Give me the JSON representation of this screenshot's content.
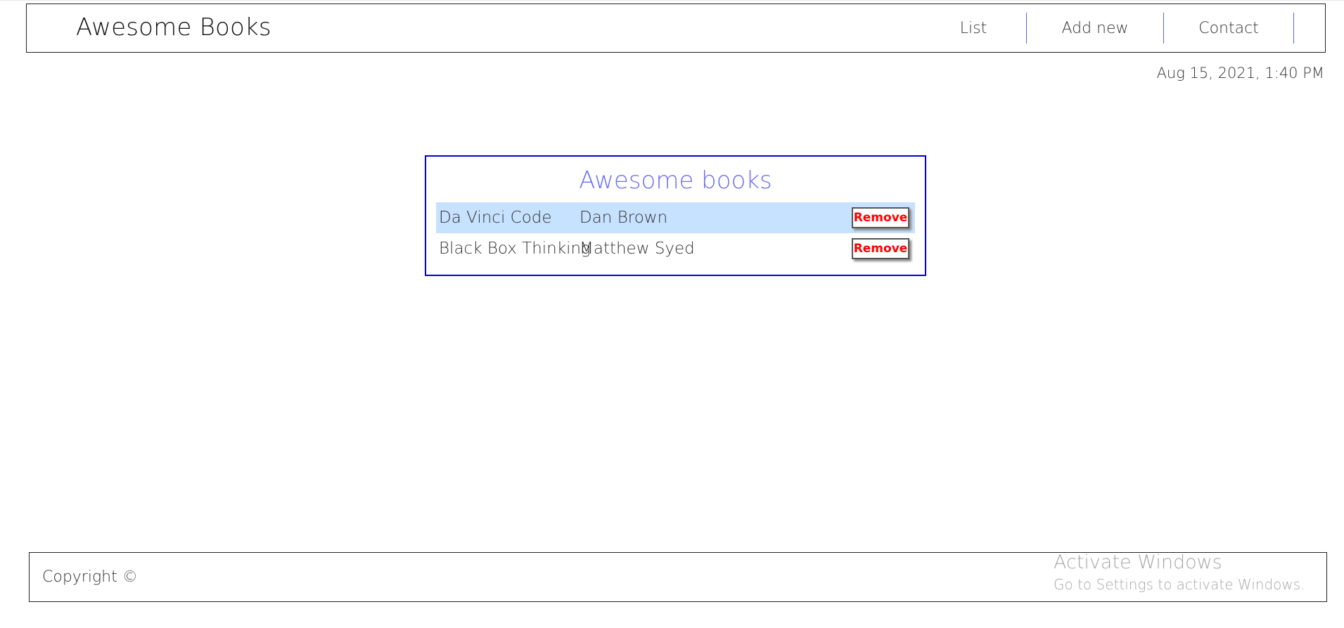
{
  "header": {
    "brand": "Awesome Books",
    "nav": [
      {
        "label": "List"
      },
      {
        "label": "Add new"
      },
      {
        "label": "Contact"
      }
    ]
  },
  "datetime": "Aug 15, 2021, 1:40 PM",
  "books_panel": {
    "title": "Awesome books",
    "books": [
      {
        "title": "Da Vinci Code",
        "author": "Dan Brown",
        "remove_label": "Remove"
      },
      {
        "title": "Black Box Thinking",
        "author": "Matthew Syed",
        "remove_label": "Remove"
      }
    ]
  },
  "footer": {
    "copyright": "Copyright ©"
  },
  "watermark": {
    "title": "Activate Windows",
    "subtitle": "Go to Settings to activate Windows."
  },
  "colors": {
    "nav_divider": "#5a63f0",
    "panel_border": "#0000d4",
    "panel_title": "#6b6ff0",
    "row_highlight": "#c7e2ff",
    "remove_text": "#ff0000"
  }
}
